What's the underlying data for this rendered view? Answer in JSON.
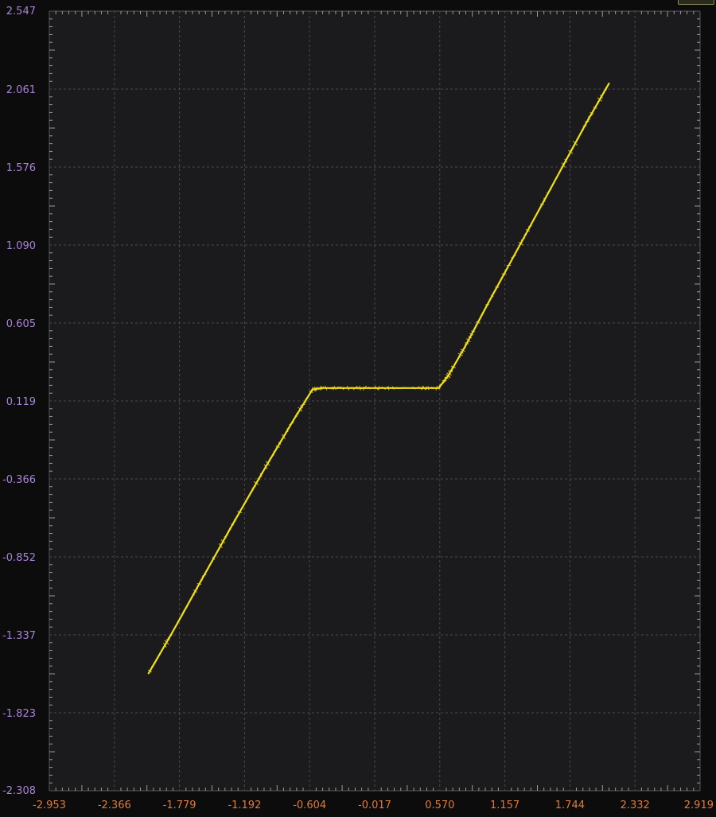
{
  "chart_data": {
    "type": "line",
    "title": "",
    "xlabel": "",
    "ylabel": "",
    "xlim": [
      -2.953,
      2.919
    ],
    "ylim": [
      -2.308,
      2.547
    ],
    "x_tick_labels": [
      "-2.953",
      "-2.366",
      "-1.779",
      "-1.192",
      "-0.604",
      "-0.017",
      "0.570",
      "1.157",
      "1.744",
      "2.332",
      "2.919"
    ],
    "y_tick_labels": [
      "2.547",
      "2.061",
      "1.576",
      "1.090",
      "0.605",
      "0.119",
      "-0.366",
      "-0.852",
      "-1.337",
      "-1.823",
      "-2.308"
    ],
    "grid": true,
    "colors": {
      "background": "#0c0c0c",
      "plot_area": "#1b1b1d",
      "grid": "#4a4a4a",
      "line": "#f2e015",
      "x_tick_text": "#e07a3c",
      "y_tick_text": "#a783d6"
    },
    "series": [
      {
        "x": [
          -2.06,
          -1.85,
          -1.6,
          -1.3,
          -1.0,
          -0.75,
          -0.58,
          -0.5,
          -0.3,
          0.0,
          0.3,
          0.56,
          0.65,
          0.8,
          1.0,
          1.3,
          1.6,
          1.9,
          2.1
        ],
        "values": [
          -1.58,
          -1.33,
          -1.02,
          -0.65,
          -0.29,
          0.0,
          0.19,
          0.2,
          0.2,
          0.2,
          0.2,
          0.2,
          0.28,
          0.46,
          0.72,
          1.1,
          1.48,
          1.86,
          2.1
        ]
      }
    ]
  }
}
